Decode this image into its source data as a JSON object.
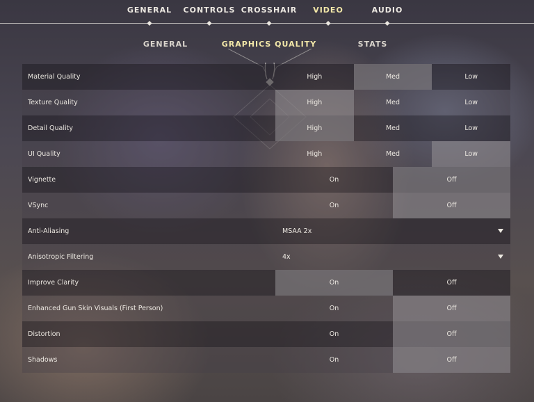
{
  "nav": {
    "tabs": [
      {
        "label": "GENERAL"
      },
      {
        "label": "CONTROLS"
      },
      {
        "label": "CROSSHAIR"
      },
      {
        "label": "VIDEO"
      },
      {
        "label": "AUDIO"
      }
    ],
    "active_tab": "VIDEO"
  },
  "subnav": {
    "tabs": [
      {
        "label": "GENERAL"
      },
      {
        "label": "GRAPHICS QUALITY"
      },
      {
        "label": "STATS"
      }
    ],
    "active_tab": "GRAPHICS QUALITY"
  },
  "settings": [
    {
      "label": "Material Quality",
      "type": "options",
      "options": [
        "High",
        "Med",
        "Low"
      ],
      "selected": 1
    },
    {
      "label": "Texture Quality",
      "type": "options",
      "options": [
        "High",
        "Med",
        "Low"
      ],
      "selected": 0
    },
    {
      "label": "Detail Quality",
      "type": "options",
      "options": [
        "High",
        "Med",
        "Low"
      ],
      "selected": 0
    },
    {
      "label": "UI Quality",
      "type": "options",
      "options": [
        "High",
        "Med",
        "Low"
      ],
      "selected": 2
    },
    {
      "label": "Vignette",
      "type": "options",
      "options": [
        "On",
        "Off"
      ],
      "selected": 1
    },
    {
      "label": "VSync",
      "type": "options",
      "options": [
        "On",
        "Off"
      ],
      "selected": 1
    },
    {
      "label": "Anti-Aliasing",
      "type": "dropdown",
      "value": "MSAA 2x"
    },
    {
      "label": "Anisotropic Filtering",
      "type": "dropdown",
      "value": "4x"
    },
    {
      "label": "Improve Clarity",
      "type": "options",
      "options": [
        "On",
        "Off"
      ],
      "selected": 0
    },
    {
      "label": "Enhanced Gun Skin Visuals (First Person)",
      "type": "options",
      "options": [
        "On",
        "Off"
      ],
      "selected": 1
    },
    {
      "label": "Distortion",
      "type": "options",
      "options": [
        "On",
        "Off"
      ],
      "selected": 1
    },
    {
      "label": "Shadows",
      "type": "options",
      "options": [
        "On",
        "Off"
      ],
      "selected": 1
    }
  ],
  "colors": {
    "accent": "#f2e7a8",
    "text": "#ece8e1"
  }
}
